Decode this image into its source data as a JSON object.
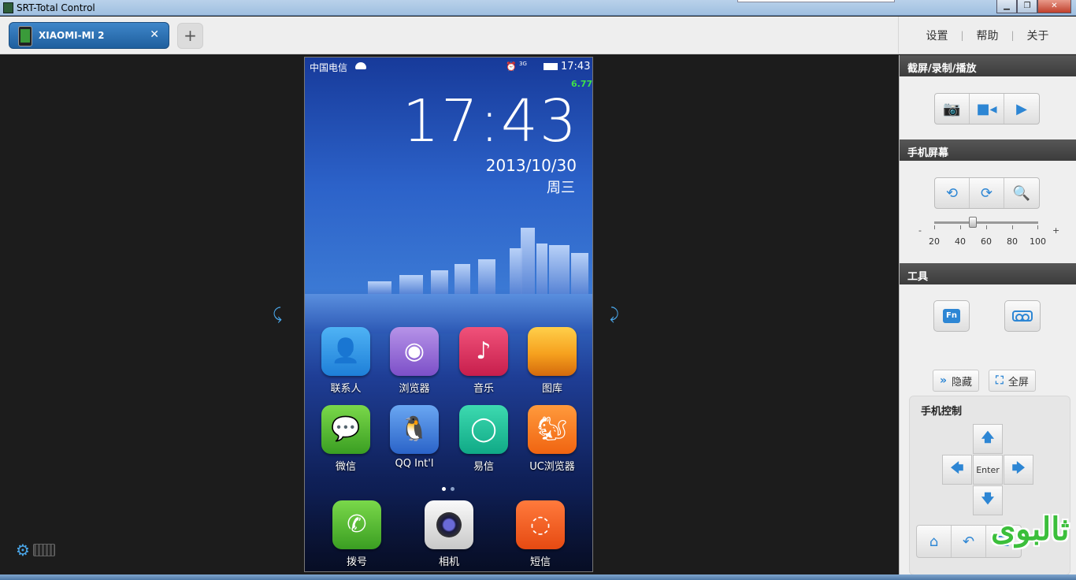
{
  "window": {
    "title": "SRT-Total Control",
    "minimize": "▁",
    "maximize": "❐",
    "close": "✕"
  },
  "tabs": {
    "device_tab": "XIAOMI-MI 2",
    "close": "✕",
    "add": "+"
  },
  "top_menu": {
    "settings": "设置",
    "help": "帮助",
    "about": "关于",
    "separator": "|"
  },
  "main": {
    "rotate_left": "⤹",
    "rotate_right": "⤸",
    "settings_gear": "⚙"
  },
  "phone": {
    "carrier": "中国电信",
    "status_time": "17:43",
    "signal_text": "3G",
    "net_speed": "6.77",
    "clock": "17:43",
    "date": "2013/10/30",
    "weekday": "周三",
    "apps": [
      {
        "label": "联系人",
        "icon": "contacts-icon",
        "glyph": "👤"
      },
      {
        "label": "浏览器",
        "icon": "browser-icon",
        "glyph": "◉"
      },
      {
        "label": "音乐",
        "icon": "music-icon",
        "glyph": "♪"
      },
      {
        "label": "图库",
        "icon": "gallery-icon",
        "glyph": ""
      },
      {
        "label": "微信",
        "icon": "wechat-icon",
        "glyph": "💬"
      },
      {
        "label": "QQ Int'l",
        "icon": "qq-icon",
        "glyph": "🐧"
      },
      {
        "label": "易信",
        "icon": "yixin-icon",
        "glyph": "◯"
      },
      {
        "label": "UC浏览器",
        "icon": "uc-browser-icon",
        "glyph": "🐿"
      }
    ],
    "dock": [
      {
        "label": "拨号",
        "icon": "phone-icon",
        "glyph": "✆"
      },
      {
        "label": "相机",
        "icon": "camera-icon",
        "glyph": ""
      },
      {
        "label": "短信",
        "icon": "sms-icon",
        "glyph": "◌"
      }
    ]
  },
  "sidebar": {
    "capture_title": "截屏/录制/播放",
    "screen_title": "手机屏幕",
    "zoom_ticks": [
      "20",
      "40",
      "60",
      "80",
      "100"
    ],
    "zoom_value": 50,
    "minus": "-",
    "plus": "+",
    "tools_title": "工具",
    "fn_label": "Fn",
    "hide": "隐藏",
    "fullscreen": "全屏",
    "control_title": "手机控制",
    "enter": "Enter"
  },
  "watermark": "ثالبوى"
}
